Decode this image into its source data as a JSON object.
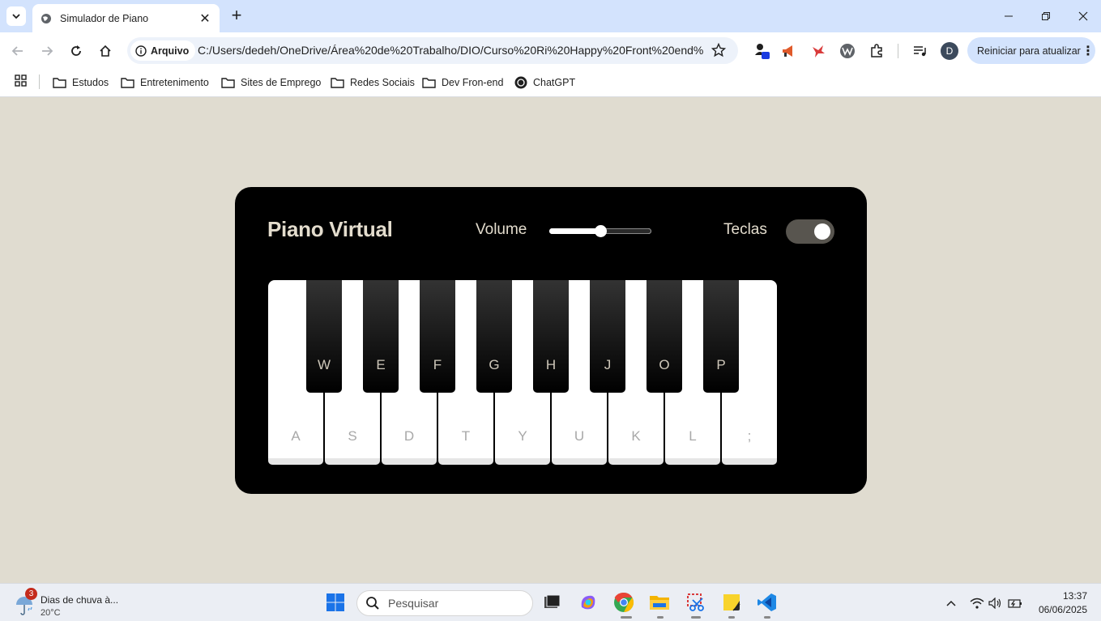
{
  "browser": {
    "tab_title": "Simulador de Piano",
    "chip_label": "Arquivo",
    "url": "C:/Users/dedeh/OneDrive/Área%20de%20Trabalho/DIO/Curso%20Ri%20Happy%20Front%20end%...",
    "profile_initial": "D",
    "update_label": "Reiniciar para atualizar",
    "bookmarks": [
      "Estudos",
      "Entretenimento",
      "Sites de Emprego",
      "Redes Sociais",
      "Dev Fron-end",
      "ChatGPT"
    ]
  },
  "app": {
    "title": "Piano Virtual",
    "volume_label": "Volume",
    "volume_level": 0.5,
    "keys_label": "Teclas",
    "keys_toggle_on": true,
    "white_keys": [
      "A",
      "S",
      "D",
      "T",
      "Y",
      "U",
      "K",
      "L",
      ";"
    ],
    "black_keys": [
      "W",
      "E",
      "F",
      "G",
      "H",
      "J",
      "O",
      "P"
    ]
  },
  "taskbar": {
    "weather_badge": "3",
    "weather_text": "Dias de chuva à...",
    "temperature": "20°C",
    "search_placeholder": "Pesquisar",
    "time": "13:37",
    "date": "06/06/2025"
  }
}
